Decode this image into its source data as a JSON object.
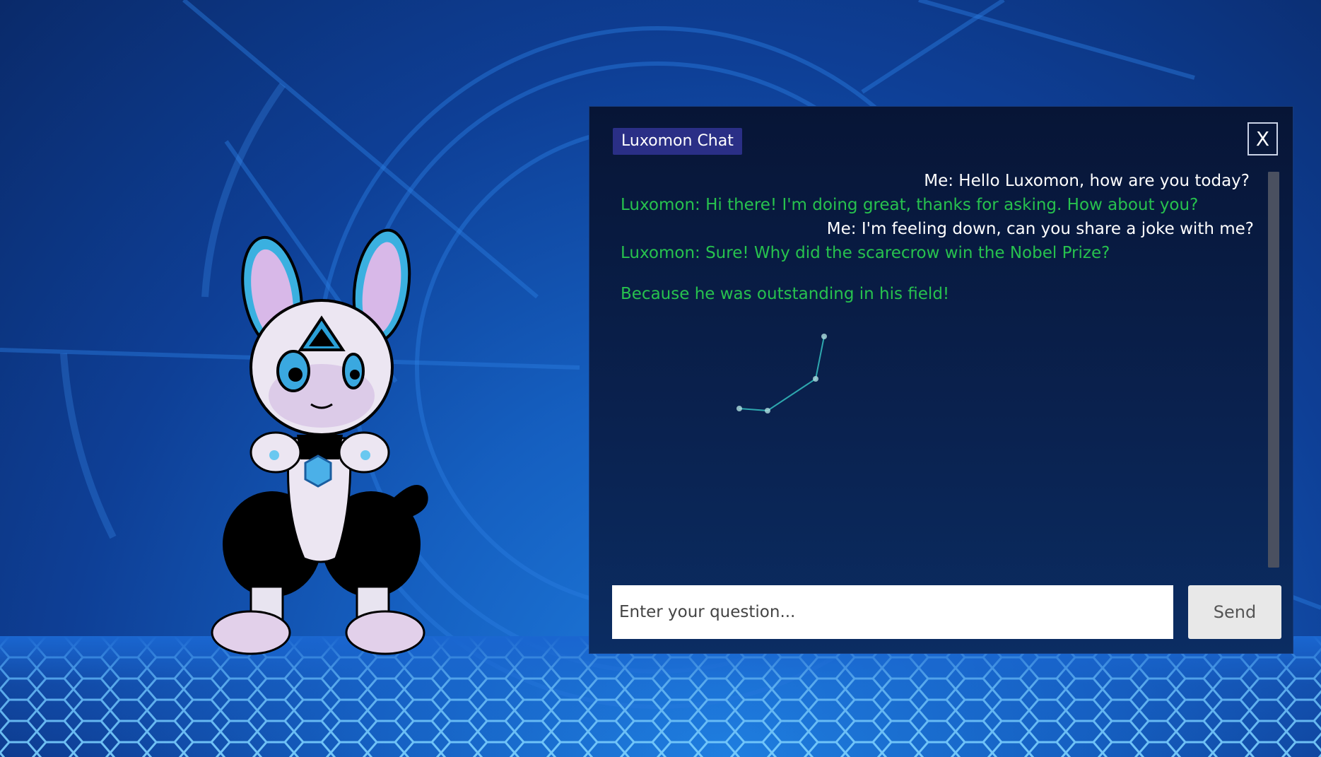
{
  "colors": {
    "panel_bg": "#071536",
    "title_bg": "#2a2f86",
    "me_text": "#ffffff",
    "bot_text": "#27c24e",
    "send_bg": "#e8e8e8"
  },
  "chat": {
    "title": "Luxomon Chat",
    "close_label": "X",
    "messages": [
      {
        "sender": "me",
        "text": "Me: Hello Luxomon, how are you today?"
      },
      {
        "sender": "bot",
        "text": "Luxomon: Hi there! I'm doing great, thanks for asking. How about you?"
      },
      {
        "sender": "me",
        "text": "Me: I'm feeling down, can you share a joke with me?"
      },
      {
        "sender": "bot",
        "text": "Luxomon: Sure! Why did the scarecrow win the Nobel Prize?"
      },
      {
        "sender": "bot",
        "text": "Because he was outstanding in his field!"
      }
    ],
    "input": {
      "placeholder": "Enter your question...",
      "value": ""
    },
    "send_label": "Send"
  },
  "icons": {
    "close": "close-icon",
    "mascot": "luxomon-mascot-icon"
  }
}
